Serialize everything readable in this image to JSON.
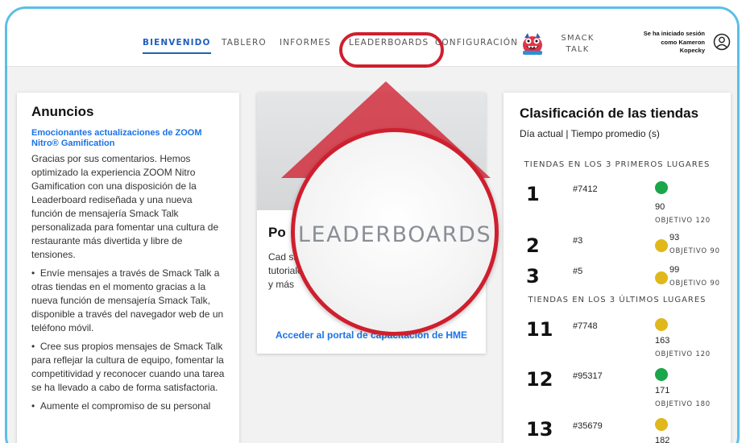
{
  "nav": {
    "items": [
      {
        "label": "BIENVENIDO",
        "active": true
      },
      {
        "label": "TABLERO"
      },
      {
        "label": "INFORMES"
      },
      {
        "label": "LEADERBOARDS"
      },
      {
        "label": "CONFIGURACIÓN"
      }
    ],
    "smack_talk": {
      "line1": "SMACK",
      "line2": "TALK",
      "icon": "monster-icon"
    },
    "login": {
      "line1": "Se ha iniciado sesión",
      "line2": "como Kameron",
      "line3": "Kopecky"
    },
    "user_icon": "user-circle-icon"
  },
  "announcements": {
    "title": "Anuncios",
    "link": "Emocionantes actualizaciones de ZOOM Nitro® Gamification",
    "paragraph": "Gracias por sus comentarios. Hemos optimizado la experiencia ZOOM Nitro Gamification con una disposición de la Leaderboard rediseñada y una nueva función de mensajería Smack Talk personalizada para fomentar una cultura de restaurante más divertida y libre de tensiones.",
    "bullets": [
      "Envíe mensajes a través de Smack Talk a otras tiendas en el momento gracias a la nueva función de mensajería Smack Talk, disponible a través del navegador web de un teléfono móvil.",
      "Cree sus propios mensajes de Smack Talk para reflejar la cultura de equipo, fomentar la competitividad y reconocer cuando una tarea se ha llevado a cabo de forma satisfactoria.",
      "Aumente el compromiso de su personal"
    ]
  },
  "portal": {
    "title": "Po",
    "body": "Cad siste constru tutoriales, trabajo y más",
    "link": "Acceder al portal de capacitación de HME"
  },
  "ranking": {
    "title": "Clasificación de las tiendas",
    "subtitle": "Día actual | Tiempo promedio (s)",
    "top_heading": "TIENDAS EN LOS 3 PRIMEROS LUGARES",
    "bottom_heading": "TIENDAS EN LOS 3 ÚLTIMOS LUGARES",
    "top": [
      {
        "pos": "1",
        "store": "#7412",
        "value": "90",
        "goal": "OBJETIVO 120",
        "status": "green"
      },
      {
        "pos": "2",
        "store": "#3",
        "value": "93",
        "goal": "OBJETIVO 90",
        "status": "yellow"
      },
      {
        "pos": "3",
        "store": "#5",
        "value": "99",
        "goal": "OBJETIVO 90",
        "status": "yellow"
      }
    ],
    "bottom": [
      {
        "pos": "11",
        "store": "#7748",
        "value": "163",
        "goal": "OBJETIVO 120",
        "status": "yellow"
      },
      {
        "pos": "12",
        "store": "#95317",
        "value": "171",
        "goal": "OBJETIVO 180",
        "status": "green"
      },
      {
        "pos": "13",
        "store": "#35679",
        "value": "182",
        "goal": "",
        "status": "yellow"
      }
    ]
  },
  "callout": {
    "zoom_label": "LEADERBOARDS"
  },
  "colors": {
    "accent_blue": "#1f5fbf",
    "link_blue": "#1a73e8",
    "callout_red": "#cf1f2e",
    "green": "#1aa64a",
    "yellow": "#e0b81b",
    "frame": "#5bbfe6"
  }
}
